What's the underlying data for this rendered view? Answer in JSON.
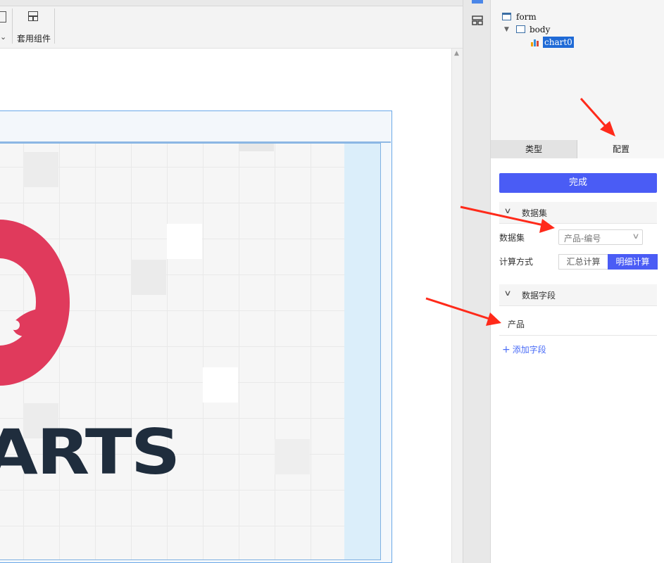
{
  "toolbar": {
    "template_label": "套用组件",
    "template_icon": "layout-grid-icon",
    "dropdown_icon": "chevron-down-icon"
  },
  "canvas": {
    "logo_text": "ARTS",
    "logo_icon": "echarts-logo-icon"
  },
  "tree": {
    "items": [
      {
        "label": "form",
        "icon": "form-icon"
      },
      {
        "label": "body",
        "icon": "body-icon"
      },
      {
        "label": "chart0",
        "icon": "chart-icon"
      }
    ]
  },
  "tabs": {
    "type": "类型",
    "config": "配置"
  },
  "config": {
    "done_button": "完成",
    "dataset_section": "数据集",
    "dataset_label": "数据集",
    "dataset_value": "产品-编号",
    "calc_label": "计算方式",
    "calc_sum": "汇总计算",
    "calc_detail": "明细计算",
    "fields_section": "数据字段",
    "field_1": "产品",
    "add_field": "添加字段"
  },
  "colors": {
    "accent": "#4a5cf5",
    "tree_selected": "#1f6ad6",
    "annotation_arrow": "#ff2a1a",
    "logo_red": "#e03a5c",
    "logo_text": "#1f2d3d"
  }
}
